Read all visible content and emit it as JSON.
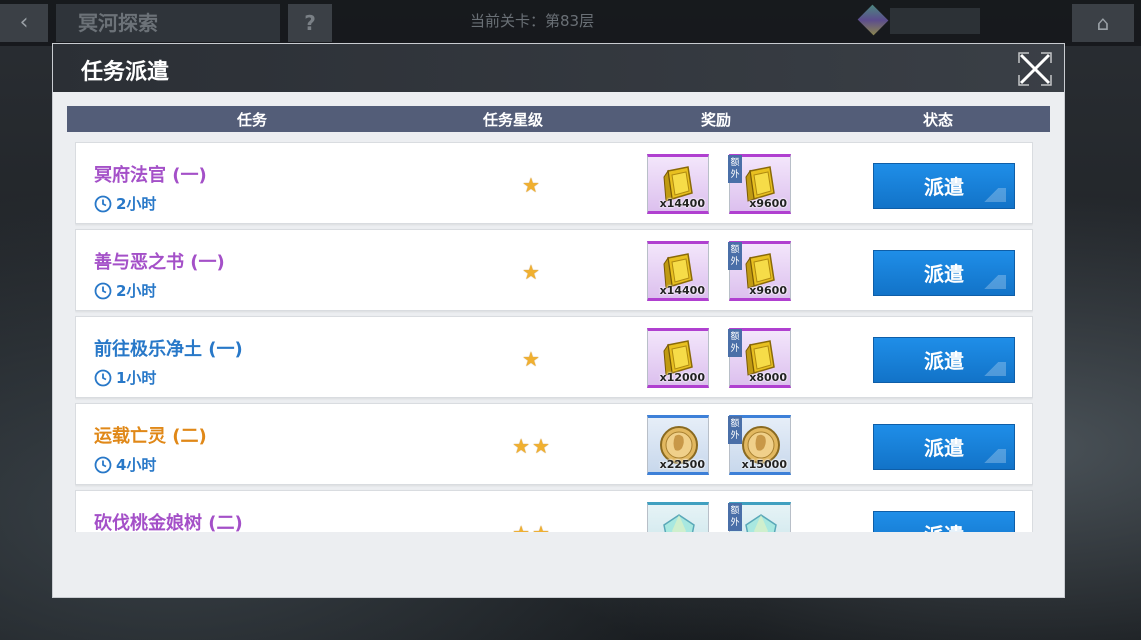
{
  "background": {
    "back_icon": "‹",
    "title": "冥河探索",
    "help_icon": "?",
    "level": "当前关卡：第83层",
    "home_icon": "⌂"
  },
  "modal": {
    "title": "任务派遣",
    "close_icon": "close-icon",
    "columns": {
      "task": "任务",
      "stars": "任务星级",
      "reward": "奖励",
      "status": "状态"
    }
  },
  "tasks": [
    {
      "name": "冥府法官 (一)",
      "name_color": "#a450c8",
      "time": "2小时",
      "stars": "★",
      "reward_type": "purple",
      "reward_icon": "gold-bar-icon",
      "reward_qty": "x14400",
      "extra_label": "额外",
      "extra_qty": "x9600",
      "button": "派遣"
    },
    {
      "name": "善与恶之书 (一)",
      "name_color": "#a450c8",
      "time": "2小时",
      "stars": "★",
      "reward_type": "purple",
      "reward_icon": "gold-bar-icon",
      "reward_qty": "x14400",
      "extra_label": "额外",
      "extra_qty": "x9600",
      "button": "派遣"
    },
    {
      "name": "前往极乐净土 (一)",
      "name_color": "#2878c8",
      "time": "1小时",
      "stars": "★",
      "reward_type": "purple",
      "reward_icon": "gold-bar-icon",
      "reward_qty": "x12000",
      "extra_label": "额外",
      "extra_qty": "x8000",
      "button": "派遣"
    },
    {
      "name": "运载亡灵 (二)",
      "name_color": "#e08818",
      "time": "4小时",
      "stars": "★★",
      "reward_type": "blue",
      "reward_icon": "coin-icon",
      "reward_qty": "x22500",
      "extra_label": "额外",
      "extra_qty": "x15000",
      "button": "派遣"
    },
    {
      "name": "砍伐桃金娘树 (二)",
      "name_color": "#a450c8",
      "time": "",
      "stars": "★★",
      "reward_type": "teal",
      "reward_icon": "crystal-icon",
      "reward_qty": "",
      "extra_label": "额外",
      "extra_qty": "",
      "button": "派遣"
    }
  ]
}
